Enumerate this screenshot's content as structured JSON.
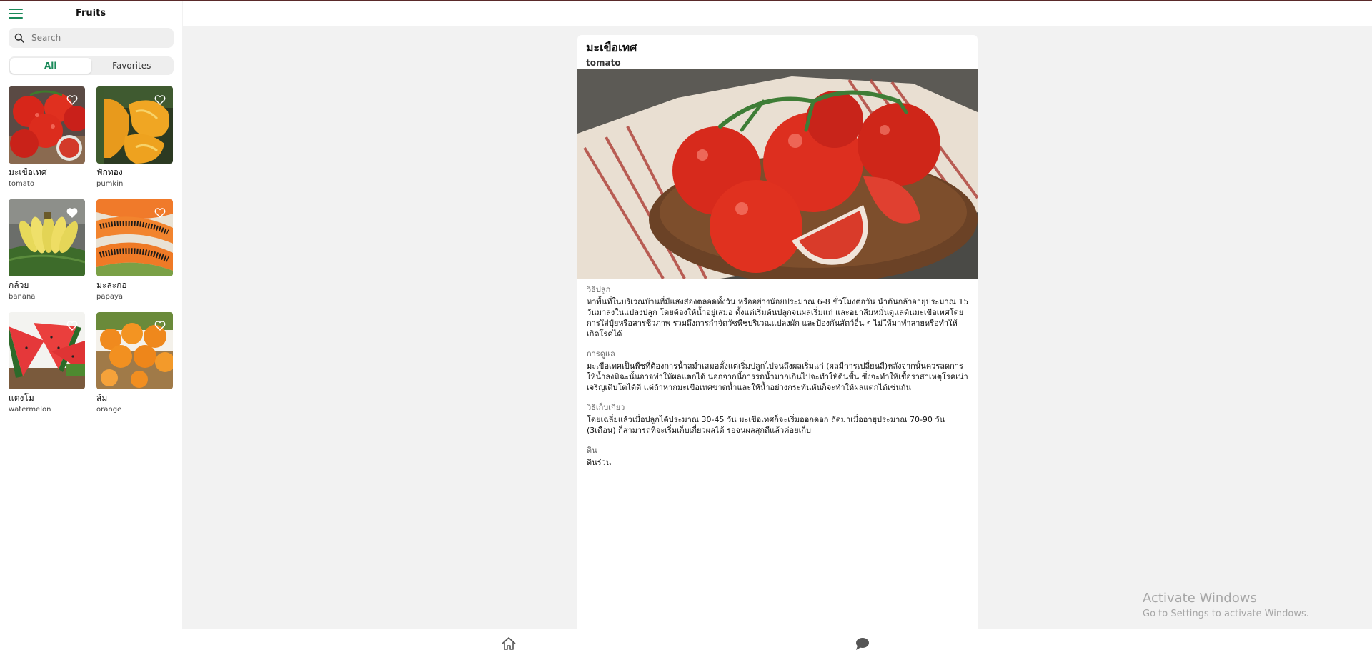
{
  "sidebar": {
    "title": "Fruits",
    "search_placeholder": "Search",
    "tabs": [
      {
        "label": "All",
        "active": true
      },
      {
        "label": "Favorites",
        "active": false
      }
    ],
    "items": [
      {
        "name_th": "มะเขือเทศ",
        "name_en": "tomato",
        "icon": "heart-outline-icon"
      },
      {
        "name_th": "ฟักทอง",
        "name_en": "pumkin",
        "icon": "heart-outline-icon"
      },
      {
        "name_th": "กล้วย",
        "name_en": "banana",
        "icon": "heart-outline-icon"
      },
      {
        "name_th": "มะละกอ",
        "name_en": "papaya",
        "icon": "heart-outline-icon"
      },
      {
        "name_th": "แตงโม",
        "name_en": "watermelon",
        "icon": "heart-outline-icon"
      },
      {
        "name_th": "ส้ม",
        "name_en": "orange",
        "icon": "heart-outline-icon"
      }
    ]
  },
  "detail": {
    "title": "มะเขือเทศ",
    "subtitle": "tomato",
    "sections": [
      {
        "label": "วิธีปลูก",
        "text": "หาพื้นที่ในบริเวณบ้านที่มีแสงส่องตลอดทั้งวัน หรืออย่างน้อยประมาณ 6-8 ชั่วโมงต่อวัน นำต้นกล้าอายุประมาณ 15 วันมาลงในแปลงปลูก โดยต้องให้น้ำอยู่เสมอ ตั้งแต่เริ่มต้นปลูกจนผลเริ่มแก่ และอย่าลืมหมั่นดูแลต้นมะเขือเทศโดยการใส่ปุ๋ยหรือสารชีวภาพ รวมถึงการกำจัดวัชพืชบริเวณแปลงผัก และป้องกันสัตว์อื่น ๆ ไม่ให้มาทำลายหรือทำให้เกิดโรคได้"
      },
      {
        "label": "การดูแล",
        "text": "มะเขือเทศเป็นพืชที่ต้องการน้ำสม่ำเสมอตั้งแต่เริ่มปลูกไปจนถึงผลเริ่มแก่ (ผลมีการเปลี่ยนสี)หลังจากนั้นควรลดการให้น้ำลงมิฉะนั้นอาจทำให้ผลแตกได้ นอกจากนี้การรดน้ำมากเกินไปจะทำให้ดินชื้น ซึ่งจะทำให้เชื้อราสาเหตุโรคเน่าเจริญเติบโตได้ดี แต่ถ้าหากมะเขือเทศขาดน้ำและให้น้ำอย่างกระทันหันก็จะทำให้ผลแตกได้เช่นกัน"
      },
      {
        "label": "วิธีเก็บเกี่ยว",
        "text": "โดยเฉลี่ยแล้วเมื่อปลูกได้ประมาณ 30-45 วัน มะเขือเทศก็จะเริ่มออกดอก ถัดมาเมื่ออายุประมาณ 70-90 วัน (3เดือน) ก็สามารถที่จะเริ่มเก็บเกี่ยวผลได้ รอจนผลสุกดีแล้วค่อยเก็บ"
      },
      {
        "label": "ดิน",
        "text": "ดินร่วน"
      }
    ]
  },
  "watermark": {
    "line1": "Activate Windows",
    "line2": "Go to Settings to activate Windows."
  },
  "bottom_nav": [
    {
      "icon": "home-icon"
    },
    {
      "icon": "chat-bubble-icon"
    }
  ],
  "colors": {
    "accent": "#1b8a5a",
    "background": "#f2f2f2",
    "panel": "#ffffff"
  }
}
